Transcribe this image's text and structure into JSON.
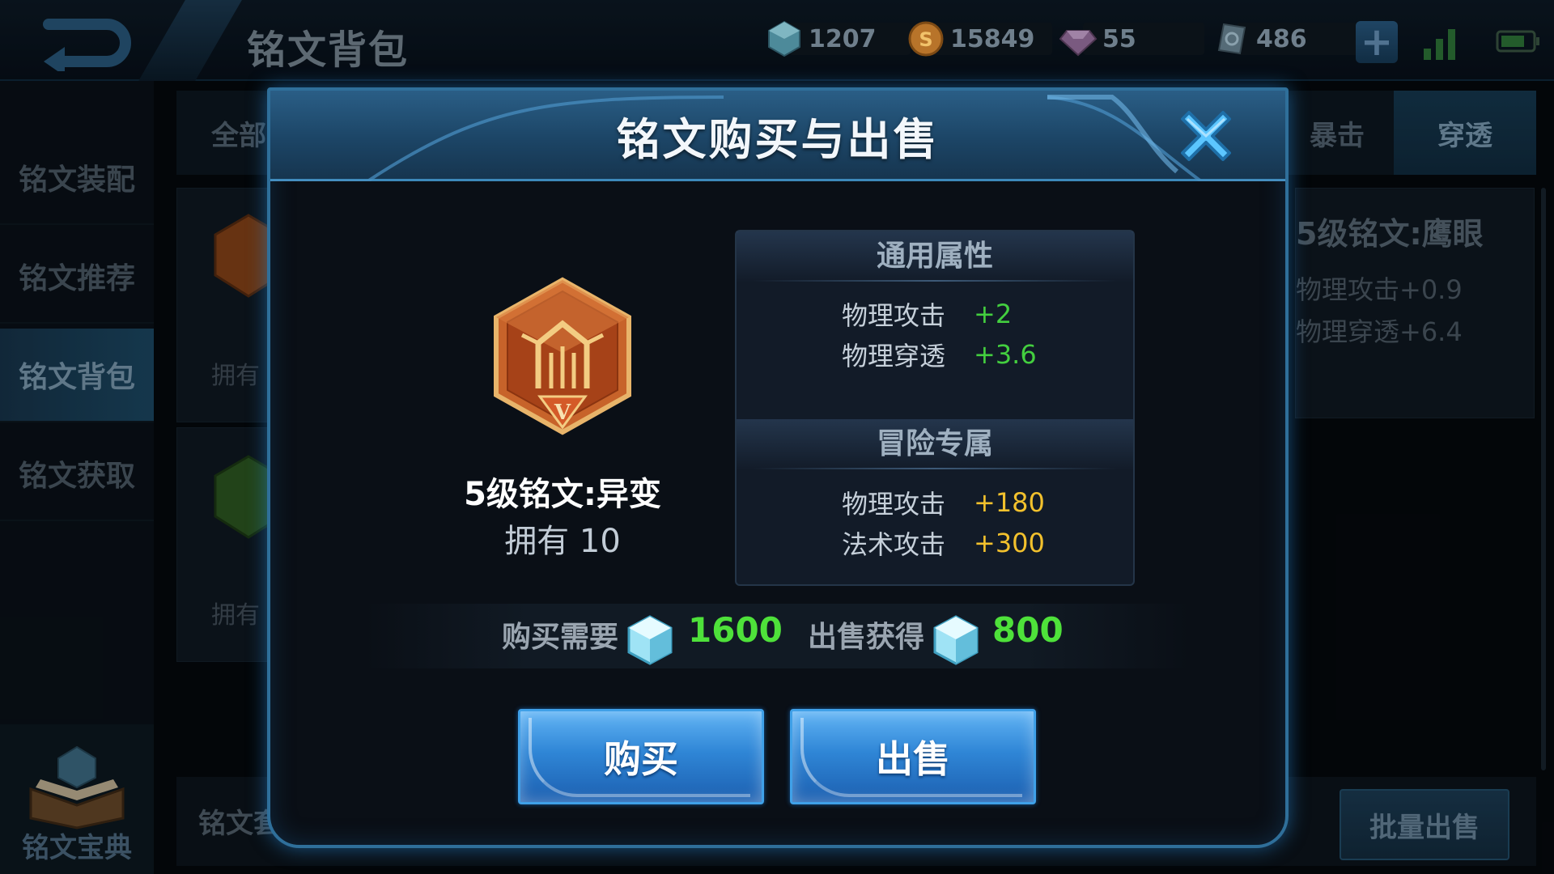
{
  "topbar": {
    "title": "铭文背包",
    "resources": [
      {
        "icon": "diamond-gem-icon",
        "value": "1207"
      },
      {
        "icon": "gold-coin-icon",
        "value": "15849"
      },
      {
        "icon": "purple-crystal-icon",
        "value": "55"
      },
      {
        "icon": "coupon-icon",
        "value": "486"
      }
    ]
  },
  "sidebar": {
    "items": [
      {
        "label": "铭文装配",
        "active": false
      },
      {
        "label": "铭文推荐",
        "active": false
      },
      {
        "label": "铭文背包",
        "active": true
      },
      {
        "label": "铭文获取",
        "active": false
      }
    ],
    "book_label": "铭文宝典"
  },
  "background": {
    "tabs": [
      "全部",
      "暴击",
      "穿透"
    ],
    "card_owned_labels": [
      "拥有",
      "拥有"
    ],
    "detail": {
      "title": "5级铭文:鹰眼",
      "lines": [
        "物理攻击+0.9",
        "物理穿透+6.4"
      ]
    },
    "bottom_label": "铭文套",
    "batch_sell_label": "批量出售"
  },
  "modal": {
    "title": "铭文购买与出售",
    "rune_name": "5级铭文:异变",
    "owned_text": "拥有 10",
    "general_header": "通用属性",
    "general_attrs": [
      {
        "name": "物理攻击",
        "value": "+2"
      },
      {
        "name": "物理穿透",
        "value": "+3.6"
      }
    ],
    "adventure_header": "冒险专属",
    "adventure_attrs": [
      {
        "name": "物理攻击",
        "value": "+180"
      },
      {
        "name": "法术攻击",
        "value": "+300"
      }
    ],
    "buy_price_label": "购买需要",
    "buy_price": "1600",
    "sell_price_label": "出售获得",
    "sell_price": "800",
    "buy_button": "购买",
    "sell_button": "出售"
  },
  "colors": {
    "accent_blue": "#2f86d6",
    "price_green": "#4ee13a",
    "attr_green": "#43cf3f",
    "attr_yellow": "#f2c12d"
  }
}
